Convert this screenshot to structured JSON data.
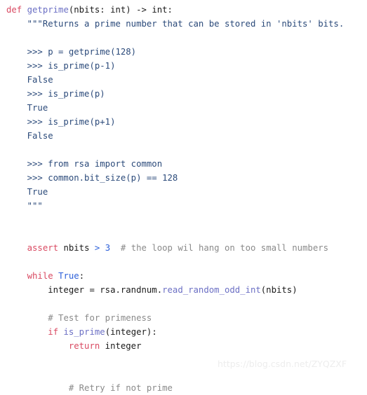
{
  "editor": {
    "language": "python",
    "background_color": "#ffffff",
    "colors": {
      "keyword": "#d94a62",
      "function": "#6b6fc4",
      "docstring": "#2b4a7a",
      "literal": "#2b5fd9",
      "comment": "#8a8a8a",
      "plain": "#1a1a1a",
      "watermark": "#ededed"
    }
  },
  "watermark": {
    "text": "https://blog.csdn.net/ZYQZXF"
  },
  "code": {
    "lines": [
      {
        "n": 1,
        "segments": [
          {
            "t": "def ",
            "c": "kw"
          },
          {
            "t": "getprime",
            "c": "fn"
          },
          {
            "t": "(nbits: int) -> int:",
            "c": "txt"
          }
        ]
      },
      {
        "n": 2,
        "segments": [
          {
            "t": "    \"\"\"Returns a prime number that can be stored in 'nbits' bits.",
            "c": "doc"
          }
        ]
      },
      {
        "n": 3,
        "segments": [
          {
            "t": "",
            "c": "txt"
          }
        ]
      },
      {
        "n": 4,
        "segments": [
          {
            "t": "    >>> p = getprime(128)",
            "c": "doc"
          }
        ]
      },
      {
        "n": 5,
        "segments": [
          {
            "t": "    >>> is_prime(p-1)",
            "c": "doc"
          }
        ]
      },
      {
        "n": 6,
        "segments": [
          {
            "t": "    False",
            "c": "doc"
          }
        ]
      },
      {
        "n": 7,
        "segments": [
          {
            "t": "    >>> is_prime(p)",
            "c": "doc"
          }
        ]
      },
      {
        "n": 8,
        "segments": [
          {
            "t": "    True",
            "c": "doc"
          }
        ]
      },
      {
        "n": 9,
        "segments": [
          {
            "t": "    >>> is_prime(p+1)",
            "c": "doc"
          }
        ]
      },
      {
        "n": 10,
        "segments": [
          {
            "t": "    False",
            "c": "doc"
          }
        ]
      },
      {
        "n": 11,
        "segments": [
          {
            "t": "",
            "c": "txt"
          }
        ]
      },
      {
        "n": 12,
        "segments": [
          {
            "t": "    >>> from rsa import common",
            "c": "doc"
          }
        ]
      },
      {
        "n": 13,
        "segments": [
          {
            "t": "    >>> common.bit_size(p) == 128",
            "c": "doc"
          }
        ]
      },
      {
        "n": 14,
        "segments": [
          {
            "t": "    True",
            "c": "doc"
          }
        ]
      },
      {
        "n": 15,
        "segments": [
          {
            "t": "    \"\"\"",
            "c": "doc"
          }
        ]
      },
      {
        "n": 16,
        "segments": [
          {
            "t": "",
            "c": "txt"
          }
        ]
      },
      {
        "n": 17,
        "segments": [
          {
            "t": "",
            "c": "txt"
          }
        ]
      },
      {
        "n": 18,
        "segments": [
          {
            "t": "    ",
            "c": "txt"
          },
          {
            "t": "assert",
            "c": "kw"
          },
          {
            "t": " nbits ",
            "c": "txt"
          },
          {
            "t": ">",
            "c": "num"
          },
          {
            "t": " ",
            "c": "txt"
          },
          {
            "t": "3",
            "c": "num"
          },
          {
            "t": "  ",
            "c": "txt"
          },
          {
            "t": "# the loop wil hang on too small numbers",
            "c": "com"
          }
        ]
      },
      {
        "n": 19,
        "segments": [
          {
            "t": "",
            "c": "txt"
          }
        ]
      },
      {
        "n": 20,
        "segments": [
          {
            "t": "    ",
            "c": "txt"
          },
          {
            "t": "while",
            "c": "kw"
          },
          {
            "t": " ",
            "c": "txt"
          },
          {
            "t": "True",
            "c": "num"
          },
          {
            "t": ":",
            "c": "txt"
          }
        ]
      },
      {
        "n": 21,
        "segments": [
          {
            "t": "        integer = rsa.randnum.",
            "c": "txt"
          },
          {
            "t": "read_random_odd_int",
            "c": "fn"
          },
          {
            "t": "(nbits)",
            "c": "txt"
          }
        ]
      },
      {
        "n": 22,
        "segments": [
          {
            "t": "",
            "c": "txt"
          }
        ]
      },
      {
        "n": 23,
        "segments": [
          {
            "t": "        ",
            "c": "txt"
          },
          {
            "t": "# Test for primeness",
            "c": "com"
          }
        ]
      },
      {
        "n": 24,
        "segments": [
          {
            "t": "        ",
            "c": "txt"
          },
          {
            "t": "if",
            "c": "kw"
          },
          {
            "t": " ",
            "c": "txt"
          },
          {
            "t": "is_prime",
            "c": "fn"
          },
          {
            "t": "(integer):",
            "c": "txt"
          }
        ]
      },
      {
        "n": 25,
        "segments": [
          {
            "t": "            ",
            "c": "txt"
          },
          {
            "t": "return",
            "c": "kw"
          },
          {
            "t": " integer",
            "c": "txt"
          }
        ]
      },
      {
        "n": 26,
        "segments": [
          {
            "t": "",
            "c": "txt"
          }
        ]
      },
      {
        "n": 27,
        "segments": [
          {
            "t": "",
            "c": "txt"
          }
        ]
      },
      {
        "n": 28,
        "segments": [
          {
            "t": "            ",
            "c": "txt"
          },
          {
            "t": "# Retry if not prime",
            "c": "com"
          }
        ]
      }
    ]
  }
}
